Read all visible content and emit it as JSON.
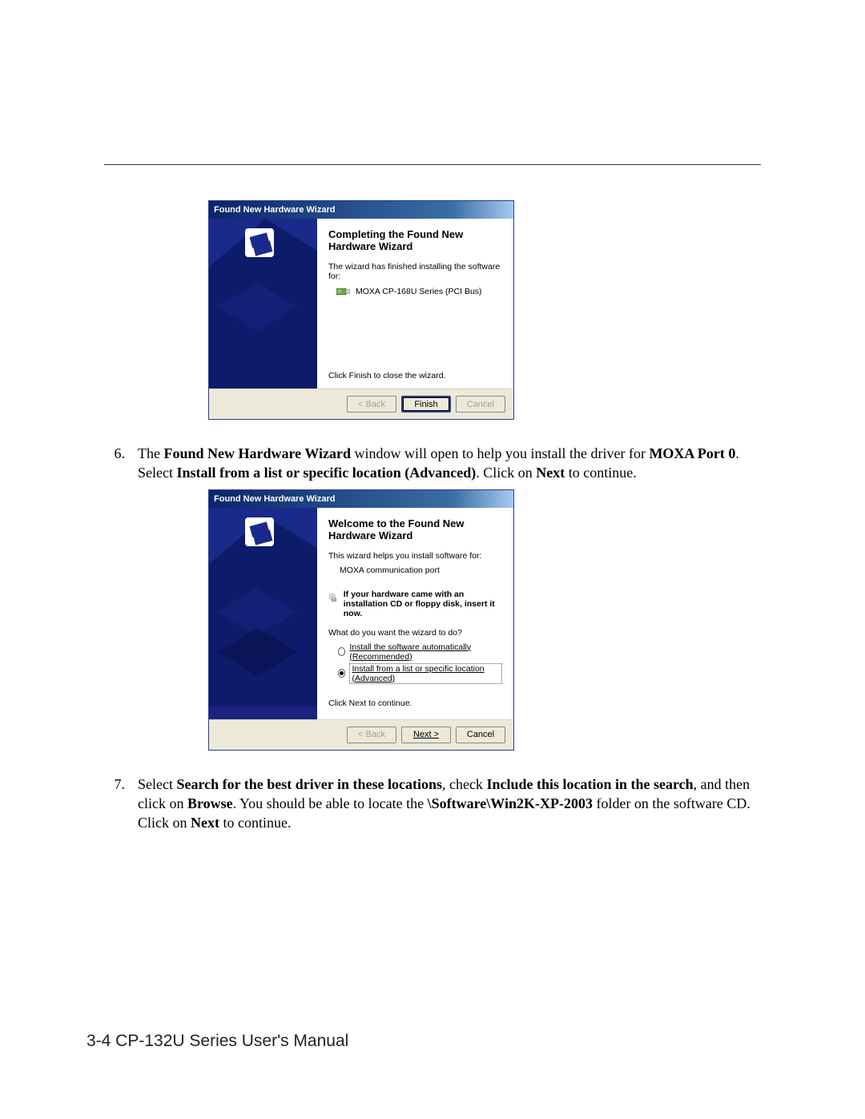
{
  "page": {
    "footer": "3-4   CP-132U Series User's Manual"
  },
  "dialog1": {
    "title": "Found New Hardware Wizard",
    "heading": "Completing the Found New Hardware Wizard",
    "subtext": "The wizard has finished installing the software for:",
    "device": "MOXA CP-168U Series (PCI Bus)",
    "close_hint": "Click Finish to close the wizard.",
    "buttons": {
      "back": "< Back",
      "finish": "Finish",
      "cancel": "Cancel"
    }
  },
  "step6": {
    "num": "6.",
    "t1": "The ",
    "b1": "Found New Hardware Wizard",
    "t2": " window will open to help you install the driver for ",
    "b2": "MOXA Port 0",
    "t3": ". Select ",
    "b3": "Install from a list or specific location (Advanced)",
    "t4": ". Click on ",
    "b4": "Next",
    "t5": " to continue."
  },
  "dialog2": {
    "title": "Found New Hardware Wizard",
    "heading": "Welcome to the Found New Hardware Wizard",
    "subtext": "This wizard helps you install software for:",
    "device": "MOXA communication port",
    "cd_note": "If your hardware came with an installation CD or floppy disk, insert it now.",
    "prompt": "What do you want the wizard to do?",
    "opt_auto": "Install the software automatically (Recommended)",
    "opt_list": "Install from a list or specific location (Advanced)",
    "next_hint": "Click Next to continue.",
    "buttons": {
      "back": "< Back",
      "next": "Next >",
      "cancel": "Cancel"
    }
  },
  "step7": {
    "num": "7.",
    "t1": "Select ",
    "b1": "Search for the best driver in these locations",
    "t2": ", check ",
    "b2": "Include this location in the search",
    "t3": ", and then click on ",
    "b3": "Browse",
    "t4": ". You should be able to locate the ",
    "b4": "\\Software\\Win2K-XP-2003",
    "t5": " folder on the software CD. Click on ",
    "b5": "Next",
    "t6": " to continue."
  }
}
